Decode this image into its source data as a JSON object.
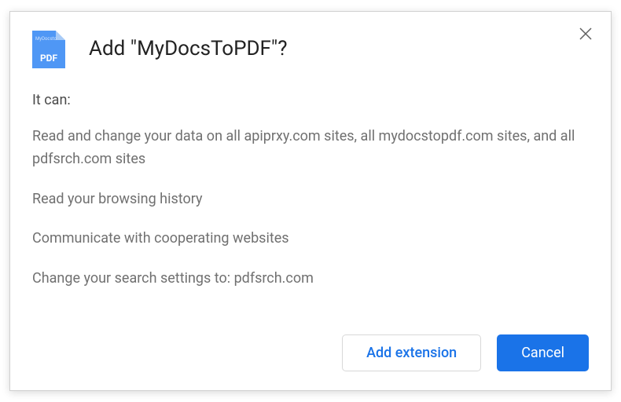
{
  "header": {
    "title": "Add \"MyDocsToPDF\"?",
    "icon_small_line1": "MyDocsto",
    "icon_pdf": "PDF"
  },
  "content": {
    "intro": "It can:",
    "permissions": [
      "Read and change your data on all apiprxy.com sites, all mydocstopdf.com sites, and all pdfsrch.com sites",
      "Read your browsing history",
      "Communicate with cooperating websites",
      "Change your search settings to: pdfsrch.com"
    ]
  },
  "footer": {
    "add_label": "Add extension",
    "cancel_label": "Cancel"
  }
}
